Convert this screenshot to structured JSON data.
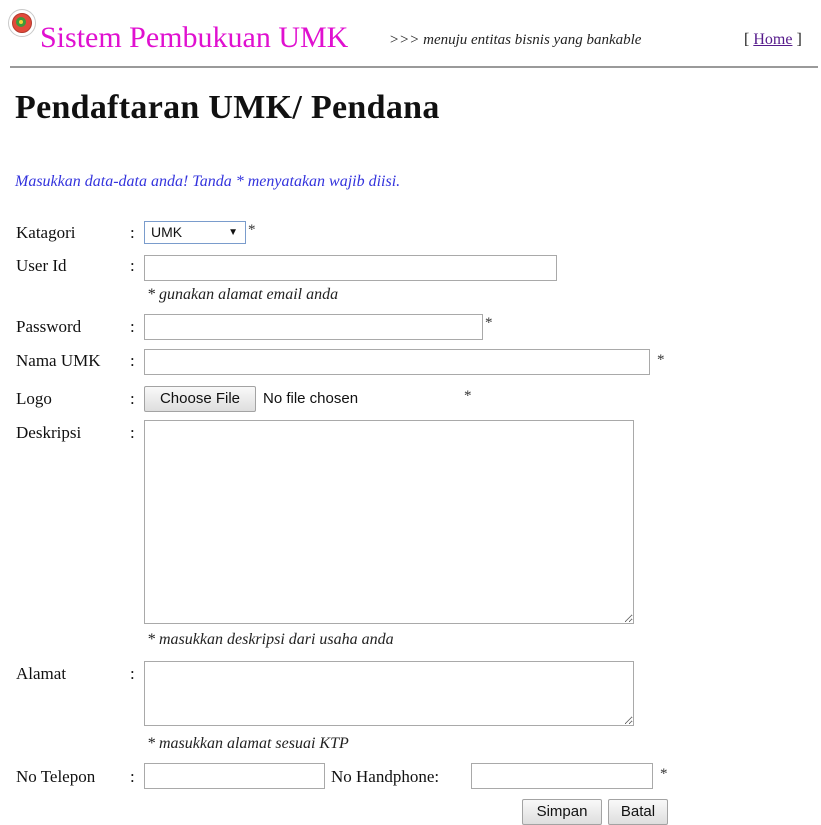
{
  "header": {
    "logo_alt": "logo",
    "site_title": "Sistem Pembukuan UMK",
    "tagline": ">>> menuju entitas bisnis yang bankable",
    "home_open": "[ ",
    "home_label": "Home",
    "home_close": " ]"
  },
  "page": {
    "title": "Pendaftaran UMK/ Pendana",
    "instructions": "Masukkan data-data anda! Tanda * menyatakan wajib diisi."
  },
  "form": {
    "colon": ":",
    "required_mark": "*",
    "kategori": {
      "label": "Katagori",
      "selected": "UMK"
    },
    "user_id": {
      "label": "User Id",
      "value": "",
      "hint": "* gunakan alamat email anda"
    },
    "password": {
      "label": "Password",
      "value": ""
    },
    "nama_umk": {
      "label": "Nama UMK",
      "value": ""
    },
    "logo": {
      "label": "Logo",
      "button": "Choose File",
      "status": "No file chosen"
    },
    "deskripsi": {
      "label": "Deskripsi",
      "value": "",
      "hint": "* masukkan deskripsi dari usaha anda"
    },
    "alamat": {
      "label": "Alamat",
      "value": "",
      "hint": "* masukkan alamat sesuai KTP"
    },
    "no_telepon": {
      "label": "No Telepon",
      "value": ""
    },
    "no_handphone": {
      "label": "No Handphone:",
      "value": ""
    },
    "buttons": {
      "save": "Simpan",
      "cancel": "Batal"
    }
  }
}
